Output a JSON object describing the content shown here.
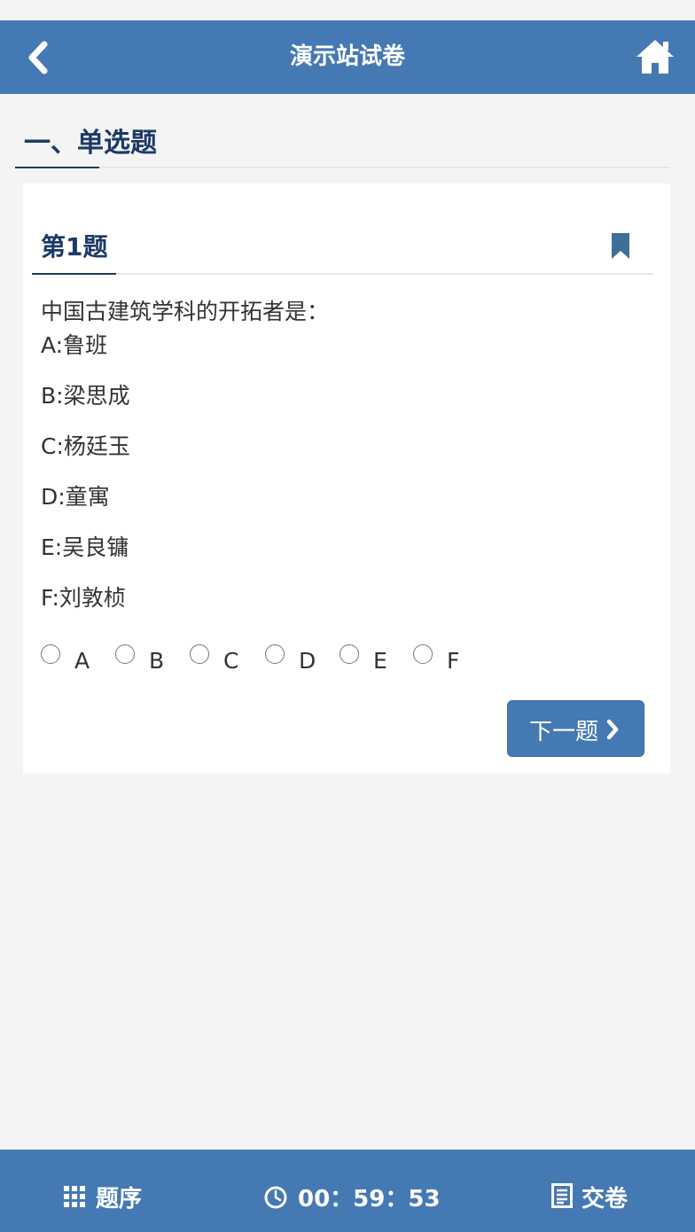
{
  "header": {
    "title": "演示站试卷",
    "back_icon": "chevron-left-icon",
    "home_icon": "home-icon"
  },
  "section": {
    "title": "一、单选题"
  },
  "question": {
    "number_label": "第1题",
    "text": "中国古建筑学科的开拓者是：",
    "bookmark_icon": "bookmark-icon",
    "options": [
      {
        "key": "A",
        "text": "A:鲁班"
      },
      {
        "key": "B",
        "text": "B:梁思成"
      },
      {
        "key": "C",
        "text": "C:杨廷玉"
      },
      {
        "key": "D",
        "text": "D:童寓"
      },
      {
        "key": "E",
        "text": "E:吴良镛"
      },
      {
        "key": "F",
        "text": "F:刘敦桢"
      }
    ],
    "choices": [
      {
        "label": "A",
        "checked": false
      },
      {
        "label": "B",
        "checked": false
      },
      {
        "label": "C",
        "checked": false
      },
      {
        "label": "D",
        "checked": false
      },
      {
        "label": "E",
        "checked": false
      },
      {
        "label": "F",
        "checked": false
      }
    ],
    "next_label": "下一题"
  },
  "footer": {
    "order_label": "题序",
    "timer": "00：59：53",
    "submit_label": "交卷"
  },
  "colors": {
    "primary": "#4579b3",
    "heading": "#1d3a66",
    "background": "#f4f4f4"
  }
}
